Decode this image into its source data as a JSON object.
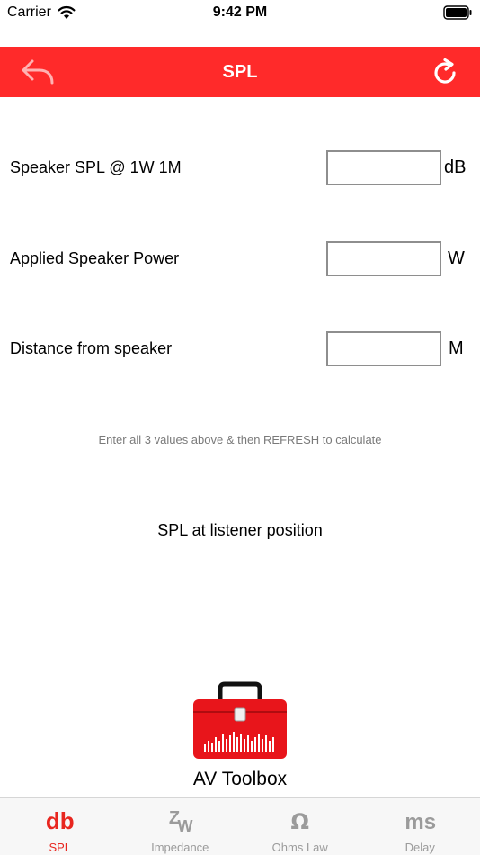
{
  "status_bar": {
    "carrier": "Carrier",
    "time": "9:42 PM"
  },
  "nav": {
    "title": "SPL",
    "back_icon": "back-arrow-icon",
    "refresh_icon": "refresh-icon"
  },
  "fields": [
    {
      "label": "Speaker SPL @ 1W 1M",
      "value": "",
      "unit": "dB"
    },
    {
      "label": "Applied Speaker Power",
      "value": "",
      "unit": "W"
    },
    {
      "label": "Distance from speaker",
      "value": "",
      "unit": "M"
    }
  ],
  "hint": "Enter all 3 values above & then REFRESH to calculate",
  "result_label": "SPL at listener position",
  "brand": {
    "name": "AV Toolbox",
    "logo_icon": "toolbox-icon"
  },
  "tabs": [
    {
      "glyph": "db",
      "label": "SPL",
      "selected": true
    },
    {
      "glyph": "ZW",
      "label": "Impedance",
      "selected": false
    },
    {
      "glyph": "Ω",
      "label": "Ohms Law",
      "selected": false
    },
    {
      "glyph": "ms",
      "label": "Delay",
      "selected": false
    }
  ],
  "colors": {
    "accent": "#ff2a2a",
    "tab_active": "#e8261f",
    "tab_inactive": "#9b9b9b",
    "hint": "#7a7a7a"
  }
}
